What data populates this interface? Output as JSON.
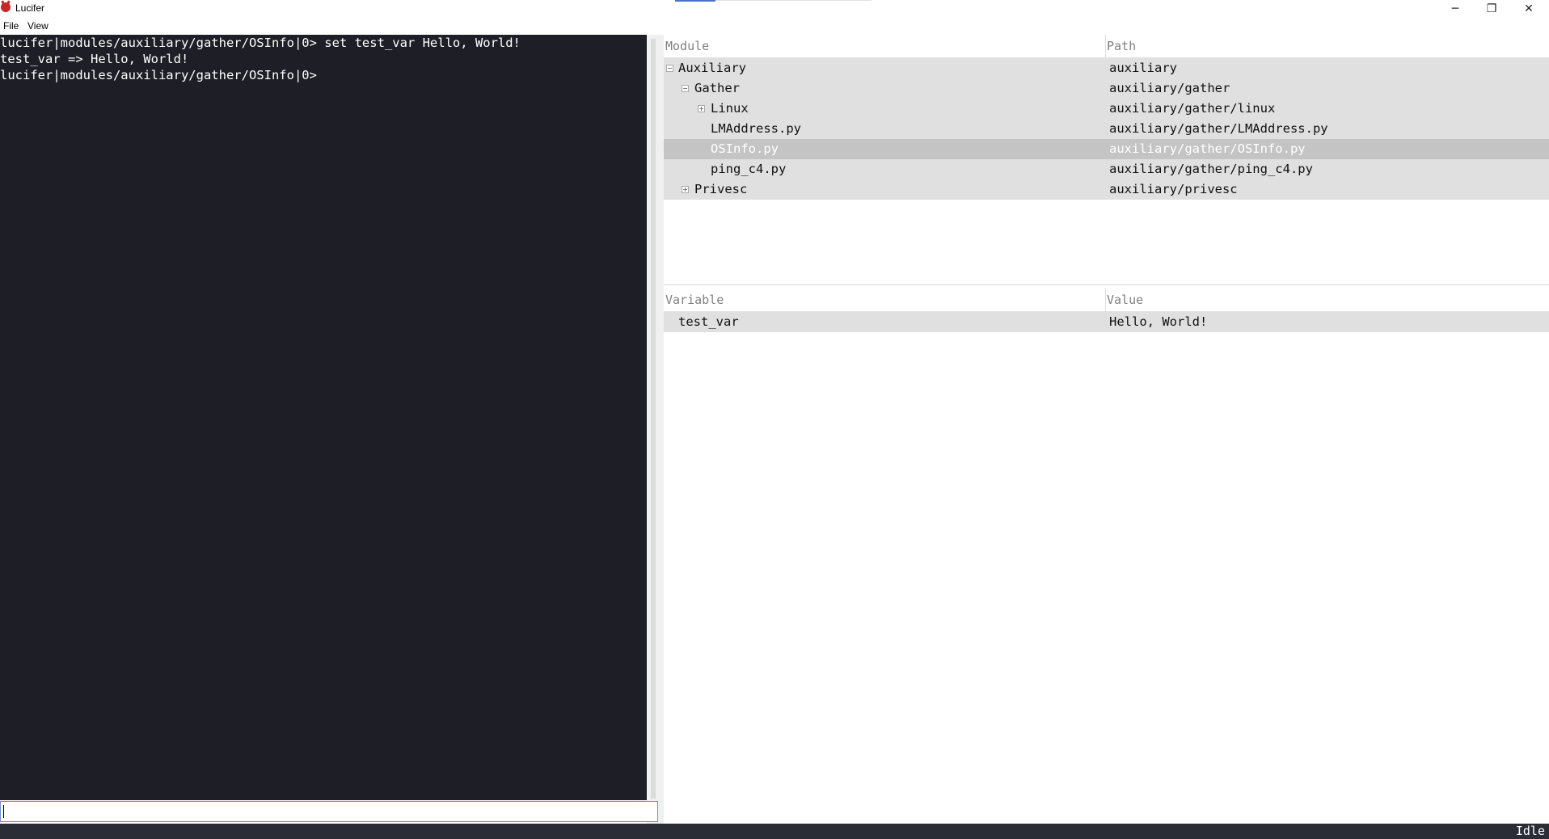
{
  "window": {
    "title": "Lucifer",
    "minimize": "─",
    "maximize": "❐",
    "close": "✕"
  },
  "menu": {
    "file": "File",
    "view": "View"
  },
  "terminal": {
    "lines": [
      "lucifer|modules/auxiliary/gather/OSInfo|0> set test_var Hello, World!",
      "test_var => Hello, World!",
      "lucifer|modules/auxiliary/gather/OSInfo|0>"
    ],
    "input_value": ""
  },
  "modules": {
    "headers": {
      "module": "Module",
      "path": "Path"
    },
    "rows": [
      {
        "name": "Auxiliary",
        "path": "auxiliary",
        "expander": "−"
      },
      {
        "name": "Gather",
        "path": "auxiliary/gather",
        "expander": "−"
      },
      {
        "name": "Linux",
        "path": "auxiliary/gather/linux",
        "expander": "+"
      },
      {
        "name": "LMAddress.py",
        "path": "auxiliary/gather/LMAddress.py"
      },
      {
        "name": "OSInfo.py",
        "path": "auxiliary/gather/OSInfo.py",
        "selected": true
      },
      {
        "name": "ping_c4.py",
        "path": "auxiliary/gather/ping_c4.py"
      },
      {
        "name": "Privesc",
        "path": "auxiliary/privesc",
        "expander": "+"
      }
    ]
  },
  "variables": {
    "headers": {
      "variable": "Variable",
      "value": "Value"
    },
    "rows": [
      {
        "name": "test_var",
        "value": "Hello, World!"
      }
    ]
  },
  "status": {
    "text": "Idle"
  },
  "colors": {
    "terminal_bg": "#1e1f26",
    "terminal_fg": "#ffffff",
    "row_bg": "#e0e0e0",
    "row_selected_bg": "#c4c4c4",
    "status_bg": "#2b2d36",
    "input_focus_border": "#6b8fd6"
  }
}
